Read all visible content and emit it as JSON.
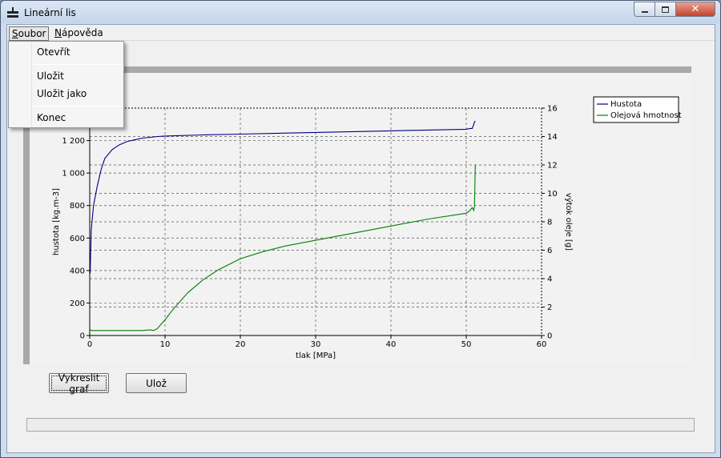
{
  "window": {
    "title": "Lineární lis"
  },
  "menu": {
    "items": [
      {
        "label": "Soubor",
        "underline": "S",
        "rest": "oubor"
      },
      {
        "label": "Nápověda",
        "underline": "N",
        "rest": "ápověda"
      }
    ],
    "soubor_dropdown": [
      "Otevřít",
      "Uložit",
      "Uložit jako",
      "Konec"
    ]
  },
  "buttons": {
    "draw": "Vykreslit graf",
    "save": "Ulož"
  },
  "colors": {
    "hustota": "#00007f",
    "olej": "#007f00",
    "close": "#c3432b"
  },
  "chart_data": {
    "type": "line",
    "xlabel": "tlak [MPa]",
    "ylabel_left": "hustota [kg.m-3]",
    "ylabel_right": "výtok oleje [g]",
    "xlim": [
      0,
      60
    ],
    "ylim_left": [
      0,
      1400
    ],
    "ylim_right": [
      0,
      16
    ],
    "x_ticks": [
      "0",
      "10",
      "20",
      "30",
      "40",
      "50",
      "60"
    ],
    "y_left_ticks": [
      "0",
      "200",
      "400",
      "600",
      "800",
      "1 000",
      "1 200"
    ],
    "y_right_ticks": [
      "0",
      "2",
      "4",
      "6",
      "8",
      "10",
      "12",
      "14",
      "16"
    ],
    "grid": true,
    "legend": "top-right",
    "series": [
      {
        "name": "Hustota",
        "axis": "left",
        "x": [
          0.05,
          0.2,
          0.5,
          1,
          1.5,
          2,
          3,
          4,
          5,
          6,
          7,
          8,
          9,
          10,
          15,
          20,
          25,
          30,
          35,
          40,
          45,
          50,
          50.5,
          50.8,
          51,
          51.1,
          51.2
        ],
        "y": [
          380,
          650,
          800,
          920,
          1020,
          1090,
          1145,
          1175,
          1195,
          1205,
          1215,
          1220,
          1225,
          1228,
          1235,
          1240,
          1245,
          1250,
          1255,
          1260,
          1265,
          1270,
          1275,
          1275,
          1300,
          1315,
          1320
        ]
      },
      {
        "name": "Olejová hmotnost",
        "axis": "right",
        "x": [
          0,
          0.3,
          1,
          5,
          7,
          8,
          8.5,
          9,
          9.5,
          10,
          11,
          13,
          15,
          17,
          20,
          23,
          26,
          30,
          35,
          40,
          45,
          50,
          50.5,
          50.8,
          51,
          51.1,
          51.2
        ],
        "y": [
          0.4,
          0.35,
          0.35,
          0.35,
          0.35,
          0.4,
          0.35,
          0.5,
          0.8,
          1.1,
          1.8,
          3.0,
          3.9,
          4.6,
          5.4,
          5.9,
          6.3,
          6.7,
          7.2,
          7.7,
          8.2,
          8.6,
          8.8,
          9.0,
          8.8,
          9.1,
          12.0
        ]
      }
    ]
  }
}
